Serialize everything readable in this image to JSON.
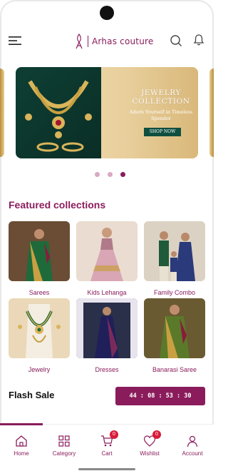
{
  "app": {
    "name": "Arhas couture"
  },
  "header": {
    "menu_icon": "hamburger-menu-icon",
    "search_icon": "search-icon",
    "notification_icon": "bell-icon"
  },
  "banner": {
    "title_line1": "JEWELRY",
    "title_line2": "COLLECTION",
    "subtitle_line1": "Adorn Yourself in Timeless",
    "subtitle_line2": "Spendor",
    "cta_label": "SHOP NOW",
    "slide_count": 3,
    "active_slide": 3
  },
  "featured": {
    "title": "Featured collections",
    "items": [
      {
        "label": "Sarees"
      },
      {
        "label": "Kids Lehanga"
      },
      {
        "label": "Family Combo"
      },
      {
        "label": "Jewelry"
      },
      {
        "label": "Dresses"
      },
      {
        "label": "Banarasi Saree"
      }
    ]
  },
  "flash_sale": {
    "title": "Flash Sale",
    "timer": "44 : 08 : 53 : 30"
  },
  "bottom_nav": {
    "items": [
      {
        "label": "Home",
        "icon": "home-icon"
      },
      {
        "label": "Category",
        "icon": "grid-icon"
      },
      {
        "label": "Cart",
        "icon": "cart-icon",
        "badge": "0"
      },
      {
        "label": "Wishlist",
        "icon": "heart-icon",
        "badge": "0"
      },
      {
        "label": "Account",
        "icon": "user-icon"
      }
    ],
    "active": "Home"
  },
  "colors": {
    "brand": "#8a1c5c",
    "badge": "#d81b3a",
    "banner_button": "#0f4f3f"
  }
}
